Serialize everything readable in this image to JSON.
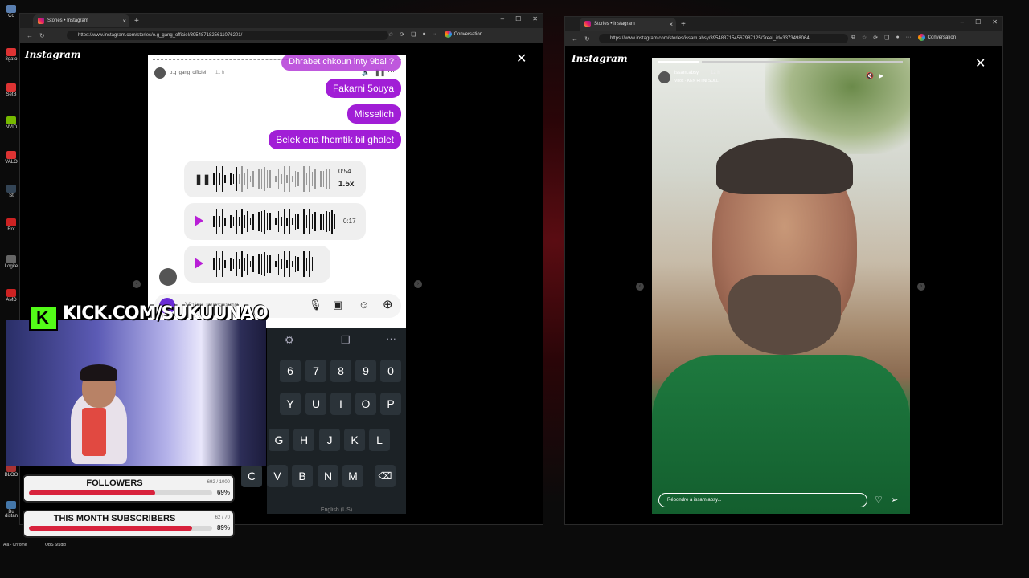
{
  "desktop": {
    "taskbar_labels": [
      "Ala - Chrome",
      "OBS Studio"
    ],
    "desktop_icons": [
      "Co",
      "8gato",
      "SetB",
      "NVID",
      "VALO",
      "St",
      "Rot",
      "Logite",
      "AMD",
      "BLOO",
      "Bu",
      "distan"
    ]
  },
  "window1": {
    "tab_title": "Stories • Instagram",
    "url": "https://www.instagram.com/stories/o.g_gang_officiel/3954871825611076201/",
    "conversation_label": "Conversation",
    "logo": "Instagram",
    "story": {
      "username": "o.g_gang_officiel",
      "time": "11 h",
      "messages": [
        "Dhrabet chkoun inty 9bal ?",
        "Fakarni 5ouya",
        "Misselich",
        "Belek ena fhemtik  bil ghalet"
      ],
      "audio": [
        {
          "duration": "0:54",
          "speed": "1.5x",
          "state": "playing"
        },
        {
          "duration": "0:17",
          "state": "paused"
        },
        {
          "duration": "",
          "state": "paused"
        }
      ],
      "composer_placeholder": "Votre message..."
    },
    "keyboard": {
      "row_numbers": [
        "6",
        "7",
        "8",
        "9",
        "0"
      ],
      "row_top": [
        "Y",
        "U",
        "I",
        "O",
        "P"
      ],
      "row_mid": [
        "G",
        "H",
        "J",
        "K",
        "L"
      ],
      "row_bottom": [
        "C",
        "V",
        "B",
        "N",
        "M"
      ],
      "language": "English (US)"
    }
  },
  "window2": {
    "tab_title": "Stories • Instagram",
    "url": "https://www.instagram.com/stories/issam.absy/3954837154567987125/?reel_id=3373498064...",
    "conversation_label": "Conversation",
    "logo": "Instagram",
    "story": {
      "username": "issam.absy",
      "time": "12 h",
      "music": "Vbox · KEN RITNI SOLLI",
      "reply_placeholder": "Répondre à issam.absy..."
    }
  },
  "stream_overlay": {
    "kick_text": "KICK.COM/SUKUUNAO",
    "followers": {
      "title": "FOLLOWERS",
      "count": "692 / 1000",
      "percent_label": "69%",
      "percent": 0.69
    },
    "subscribers": {
      "title": "THIS MONTH SUBSCRIBERS",
      "count": "62 / 70",
      "percent_label": "89%",
      "percent": 0.89
    }
  }
}
